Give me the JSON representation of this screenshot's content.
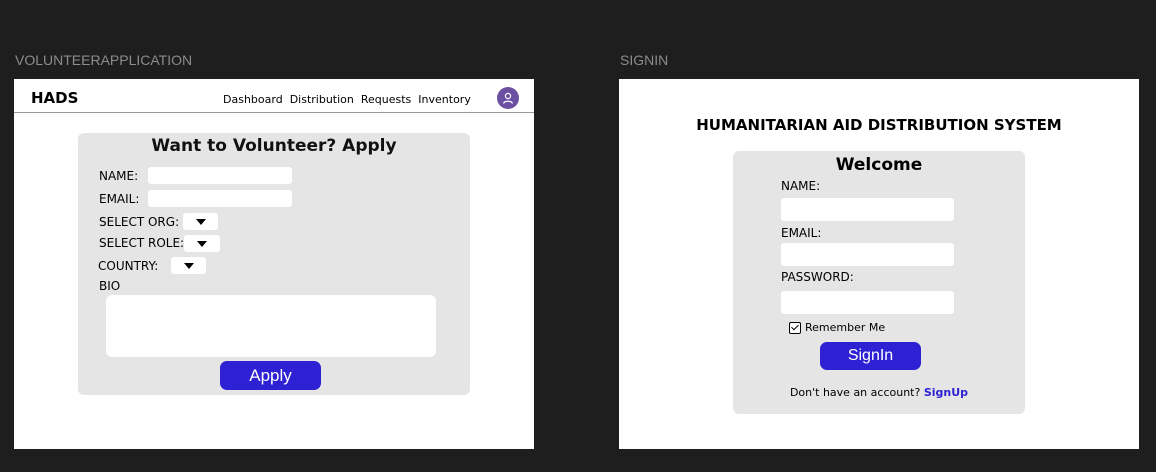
{
  "frames": {
    "volunteer_label": "VOLUNTEERAPPLICATION",
    "signin_label": "SIGNIN"
  },
  "volunteer": {
    "brand": "HADS",
    "nav": [
      "Dashboard",
      "Distribution",
      "Requests",
      "Inventory"
    ],
    "avatar_icon": "user-icon",
    "title": "Want to Volunteer? Apply",
    "name_label": "NAME:",
    "email_label": "EMAIL:",
    "org_label": "SELECT ORG:",
    "role_label": "SELECT ROLE:",
    "country_label": "COUNTRY:",
    "bio_label": "BIO",
    "apply_label": "Apply"
  },
  "signin": {
    "system_title": "HUMANITARIAN AID DISTRIBUTION SYSTEM",
    "welcome": "Welcome",
    "name_label": "NAME:",
    "email_label": "EMAIL:",
    "password_label": "PASSWORD:",
    "remember_label": "Remember Me",
    "remember_checked": true,
    "signin_label": "SignIn",
    "no_account_text": "Don't have an account?",
    "signup_label": "SignUp"
  },
  "colors": {
    "background": "#1e1e1e",
    "card": "#e5e5e5",
    "accent": "#2d21d3",
    "avatar": "#6b4fa3"
  }
}
